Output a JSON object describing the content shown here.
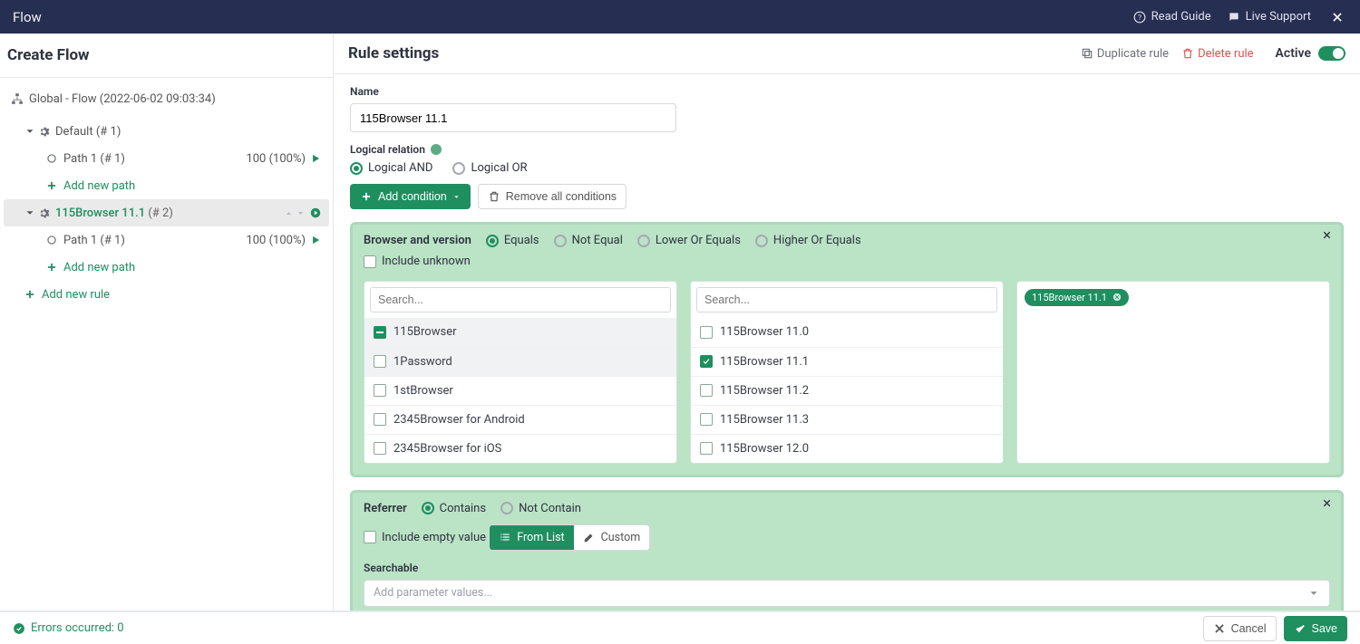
{
  "topbar": {
    "title": "Flow",
    "read_guide": "Read Guide",
    "live_support": "Live Support"
  },
  "sidebar": {
    "title": "Create Flow",
    "root": "Global - Flow (2022-06-02 09:03:34)",
    "rules": [
      {
        "name": "Default",
        "suffix": "(# 1)",
        "paths": [
          {
            "name": "Path 1 (# 1)",
            "stats": "100 (100%)"
          }
        ]
      },
      {
        "name": "115Browser 11.1",
        "suffix": "(# 2)",
        "selected": true,
        "paths": [
          {
            "name": "Path 1 (# 1)",
            "stats": "100 (100%)"
          }
        ]
      }
    ],
    "add_path": "Add new path",
    "add_rule": "Add new rule"
  },
  "main": {
    "title": "Rule settings",
    "duplicate": "Duplicate rule",
    "delete": "Delete rule",
    "active_label": "Active",
    "name_label": "Name",
    "name_value": "115Browser 11.1",
    "logic_label": "Logical relation",
    "logic_and": "Logical AND",
    "logic_or": "Logical OR",
    "add_condition": "Add condition",
    "remove_all": "Remove all conditions"
  },
  "cond1": {
    "title": "Browser and version",
    "ops": [
      "Equals",
      "Not Equal",
      "Lower Or Equals",
      "Higher Or Equals"
    ],
    "selected_op": 0,
    "include_unknown": "Include unknown",
    "search_placeholder": "Search...",
    "left_list": [
      {
        "label": "115Browser",
        "state": "indet"
      },
      {
        "label": "1Password",
        "state": "off",
        "shaded": true
      },
      {
        "label": "1stBrowser",
        "state": "off"
      },
      {
        "label": "2345Browser for Android",
        "state": "off"
      },
      {
        "label": "2345Browser for iOS",
        "state": "off"
      }
    ],
    "right_list": [
      {
        "label": "115Browser 11.0",
        "state": "off"
      },
      {
        "label": "115Browser 11.1",
        "state": "checked"
      },
      {
        "label": "115Browser 11.2",
        "state": "off"
      },
      {
        "label": "115Browser 11.3",
        "state": "off"
      },
      {
        "label": "115Browser 12.0",
        "state": "off"
      }
    ],
    "chip": "115Browser 11.1"
  },
  "cond2": {
    "title": "Referrer",
    "ops": [
      "Contains",
      "Not Contain"
    ],
    "selected_op": 0,
    "include_empty": "Include empty value",
    "from_list": "From List",
    "custom": "Custom",
    "searchable": "Searchable",
    "placeholder": "Add parameter values..."
  },
  "footer": {
    "errors": "Errors occurred: 0",
    "cancel": "Cancel",
    "save": "Save"
  }
}
